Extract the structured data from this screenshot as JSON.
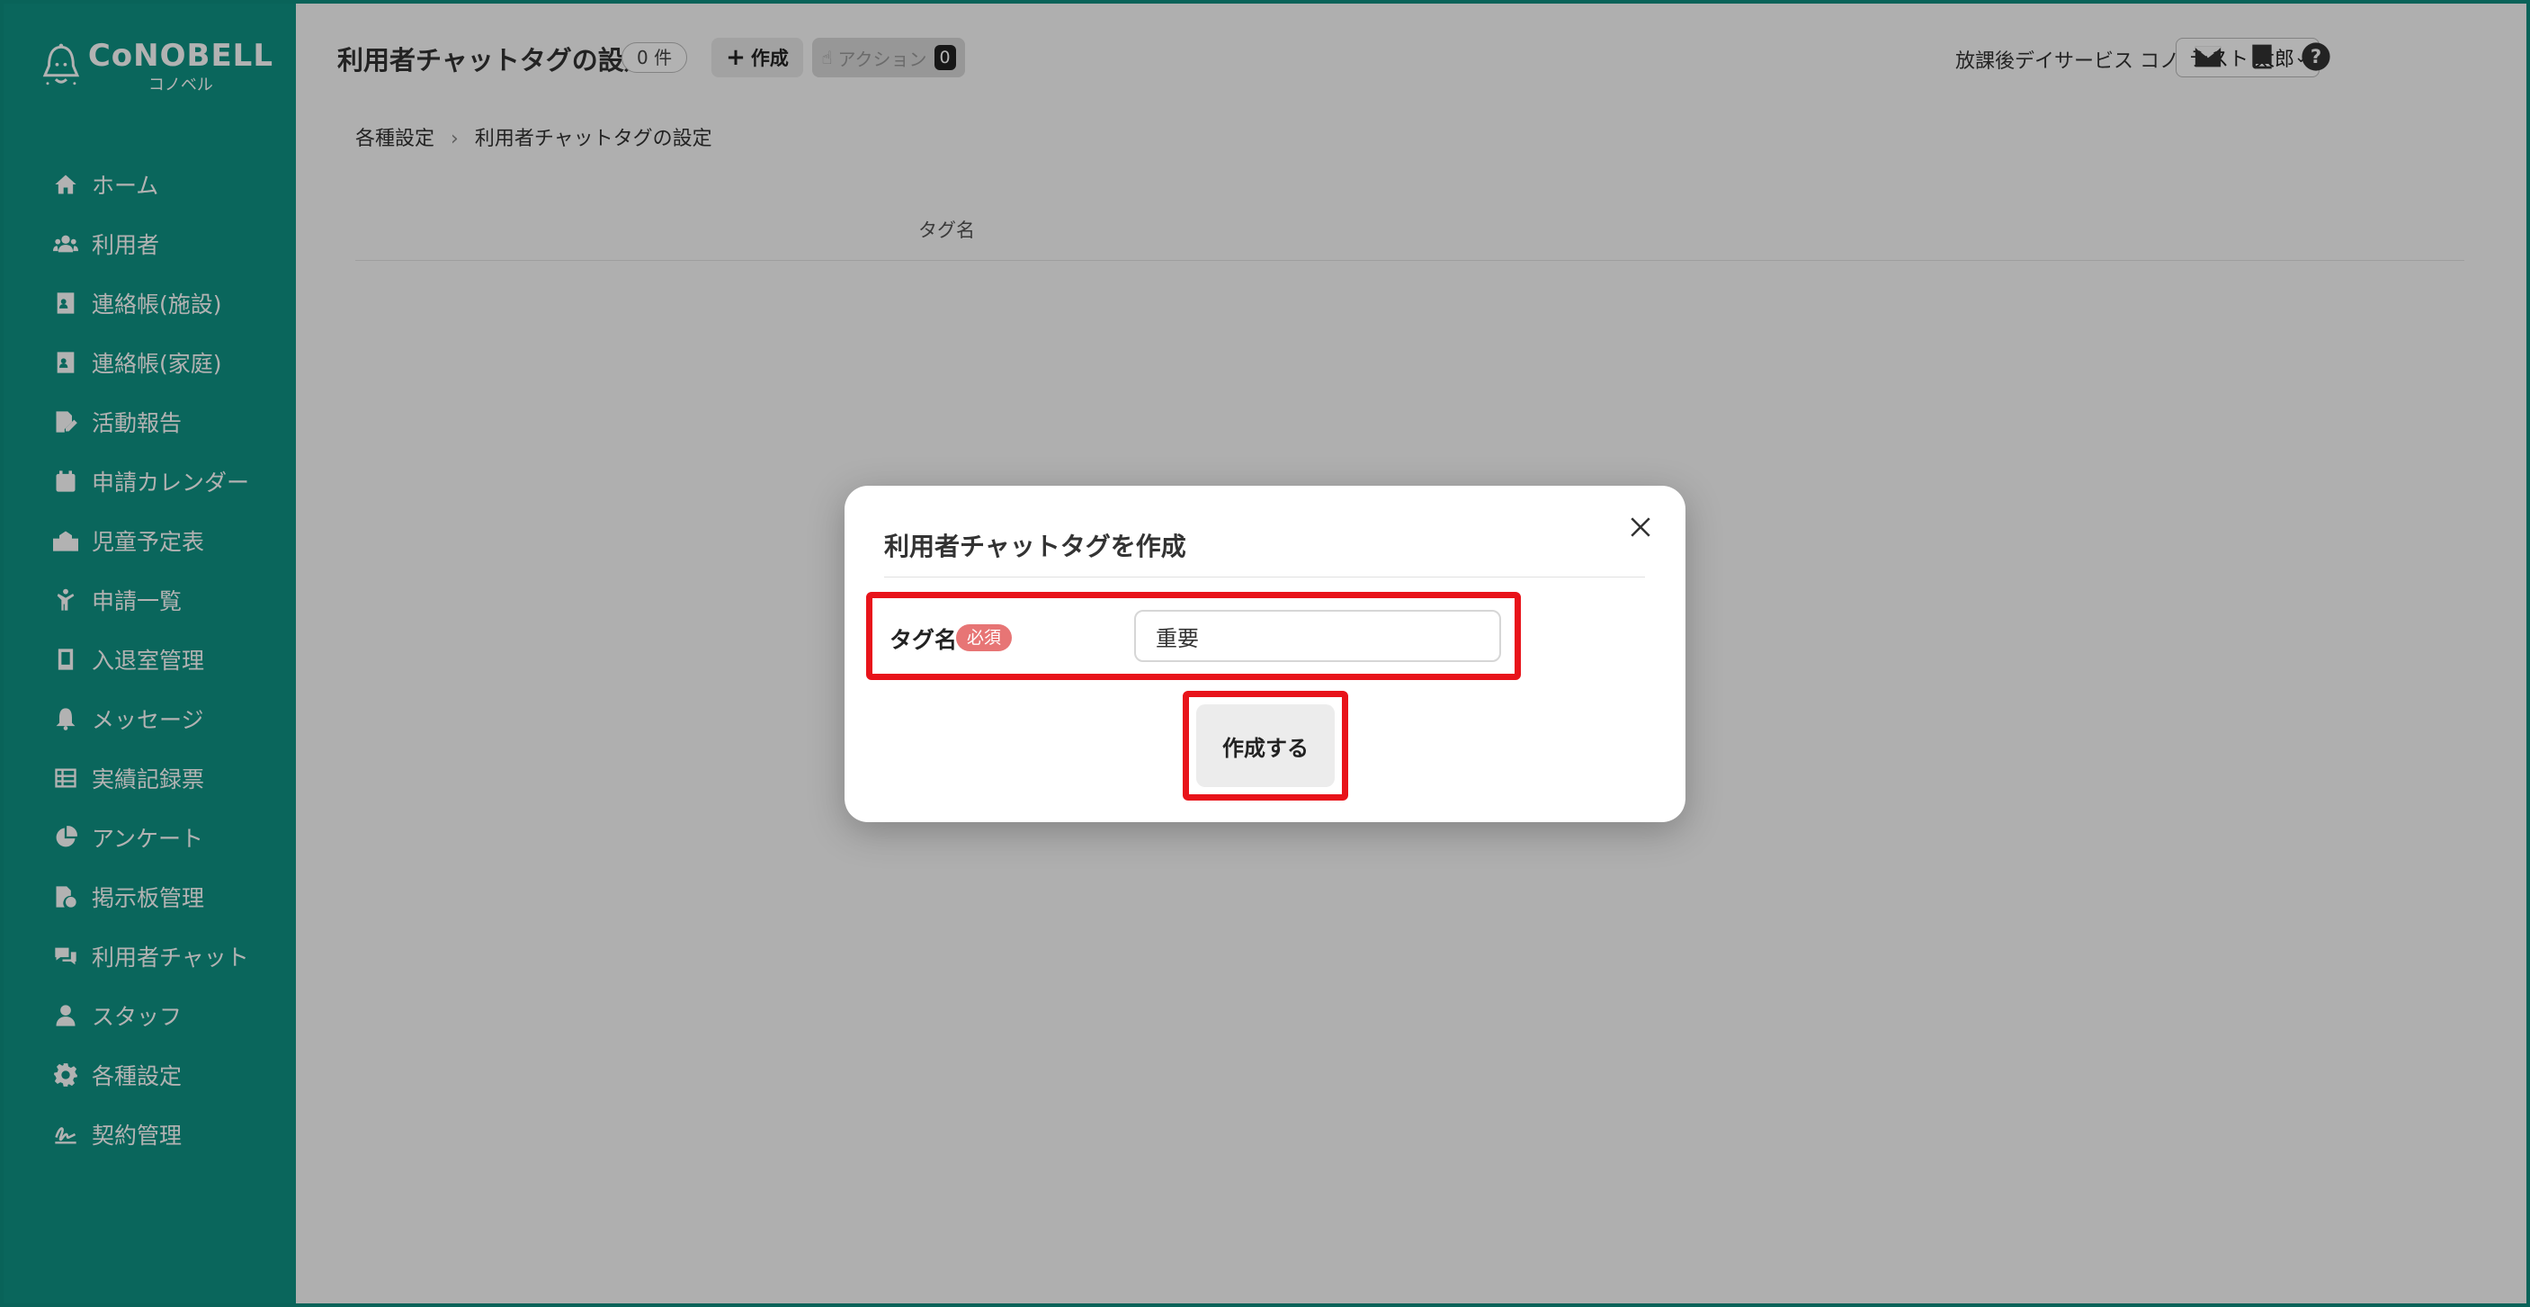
{
  "brand": {
    "name": "CoNOBELL",
    "sub": "コノベル"
  },
  "sidebar": {
    "items": [
      {
        "label": "ホーム",
        "icon": "home-icon"
      },
      {
        "label": "利用者",
        "icon": "users-icon"
      },
      {
        "label": "連絡帳(施設)",
        "icon": "contact-book-icon"
      },
      {
        "label": "連絡帳(家庭)",
        "icon": "contact-book-icon"
      },
      {
        "label": "活動報告",
        "icon": "report-edit-icon"
      },
      {
        "label": "申請カレンダー",
        "icon": "calendar-icon"
      },
      {
        "label": "児童予定表",
        "icon": "school-icon"
      },
      {
        "label": "申請一覧",
        "icon": "child-icon"
      },
      {
        "label": "入退室管理",
        "icon": "tablet-icon"
      },
      {
        "label": "メッセージ",
        "icon": "bell-icon"
      },
      {
        "label": "実績記録票",
        "icon": "table-icon"
      },
      {
        "label": "アンケート",
        "icon": "pie-chart-icon"
      },
      {
        "label": "掲示板管理",
        "icon": "file-check-icon"
      },
      {
        "label": "利用者チャット",
        "icon": "chat-icon"
      },
      {
        "label": "スタッフ",
        "icon": "staff-icon"
      },
      {
        "label": "各種設定",
        "icon": "gear-icon"
      },
      {
        "label": "契約管理",
        "icon": "signature-icon"
      }
    ]
  },
  "header": {
    "title": "利用者チャットタグの設定",
    "count": "0 件",
    "create_label": "作成",
    "action_label": "アクション",
    "action_count": "0",
    "facility": "放課後デイサービス コノベル",
    "user": "テスト 太郎"
  },
  "breadcrumb": {
    "parent": "各種設定",
    "current": "利用者チャットタグの設定"
  },
  "table": {
    "column": "タグ名"
  },
  "modal": {
    "title": "利用者チャットタグを作成",
    "field_label": "タグ名",
    "required": "必須",
    "input_value": "重要",
    "submit_label": "作成する"
  },
  "colors": {
    "brand": "#0f9384",
    "highlight": "#e8131a",
    "required": "#e77575"
  }
}
